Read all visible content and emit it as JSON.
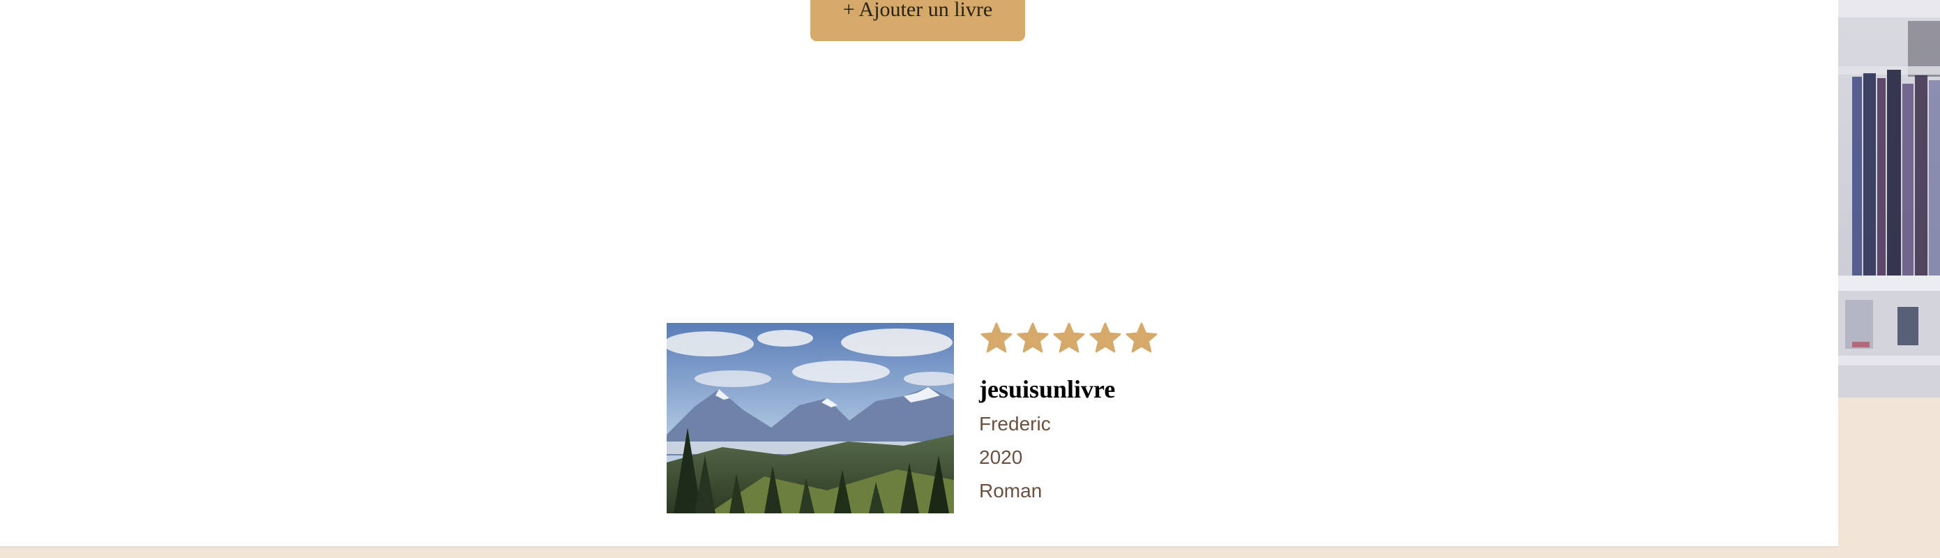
{
  "toolbar": {
    "add_book_label": "+ Ajouter un livre"
  },
  "book": {
    "title": "jesuisunlivre",
    "author": "Frederic",
    "year": "2020",
    "genre": "Roman",
    "rating": 5,
    "rating_max": 5,
    "cover_image": "mountain-landscape"
  },
  "colors": {
    "accent": "#d4a96a",
    "meta_text": "#6b5040",
    "beige": "#f0e5d7"
  }
}
